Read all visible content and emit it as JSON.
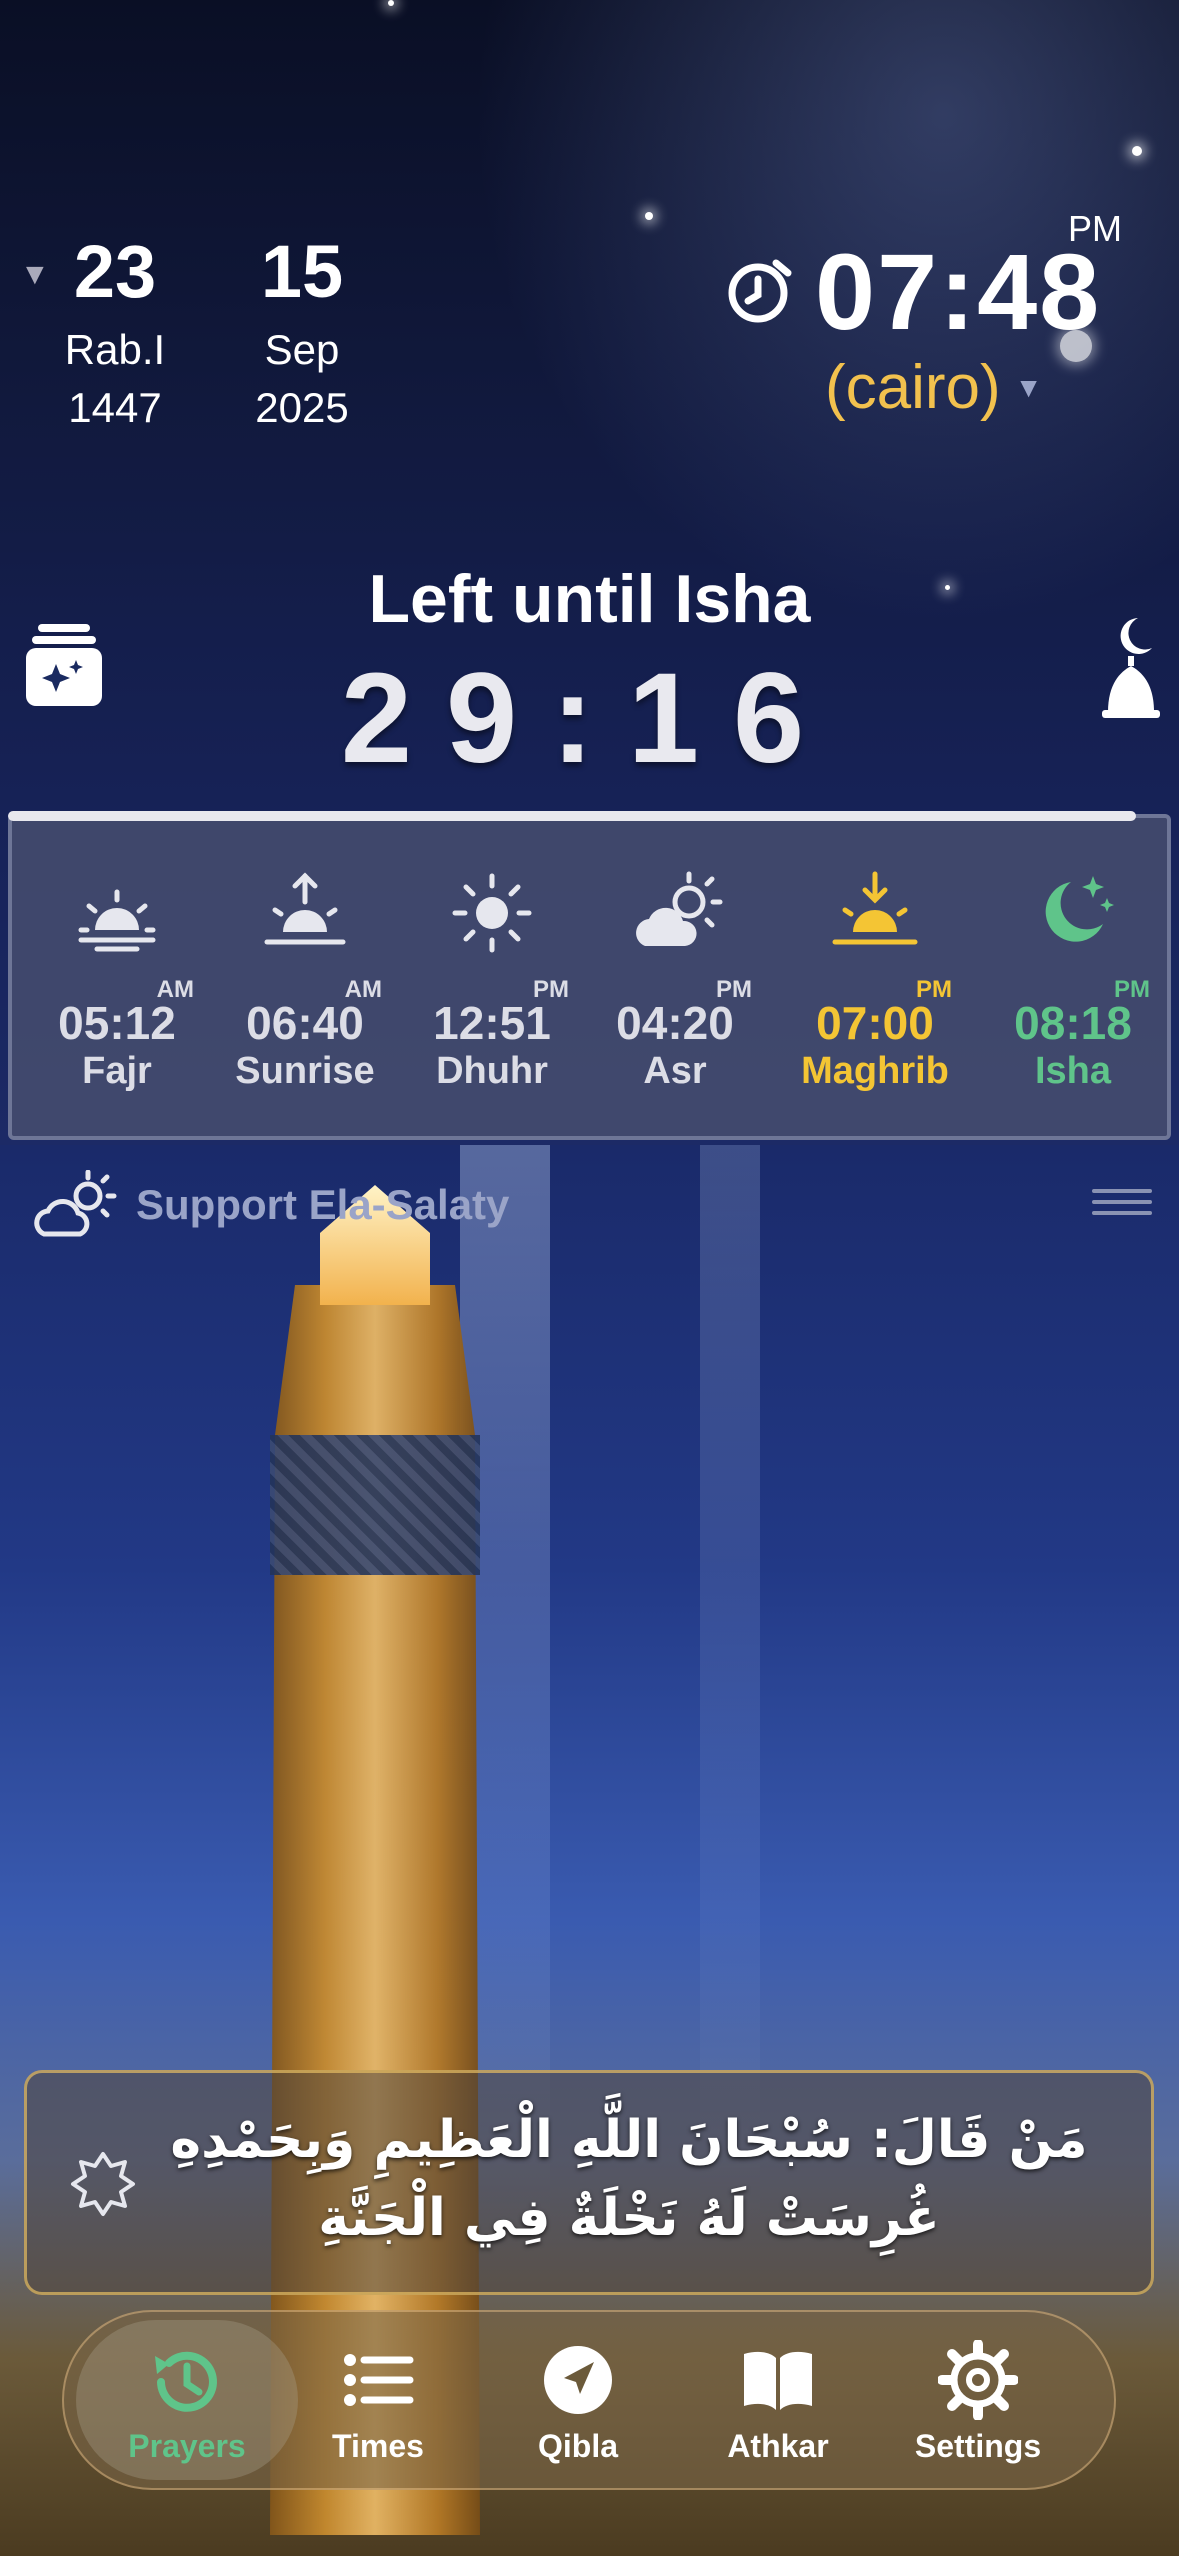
{
  "hijri": {
    "day": "23",
    "month": "Rab.I",
    "year": "1447"
  },
  "gregorian": {
    "day": "15",
    "month": "Sep",
    "year": "2025"
  },
  "clock": {
    "ampm": "PM",
    "time": "07:48",
    "city": "(cairo)"
  },
  "countdown": {
    "title": "Left until Isha",
    "value": "29:16",
    "progress_fraction": 0.97
  },
  "prayers": [
    {
      "name": "Fajr",
      "time": "05:12",
      "ampm": "AM",
      "icon": "sunrise-icon",
      "state": "normal"
    },
    {
      "name": "Sunrise",
      "time": "06:40",
      "ampm": "AM",
      "icon": "sun-up-icon",
      "state": "normal"
    },
    {
      "name": "Dhuhr",
      "time": "12:51",
      "ampm": "PM",
      "icon": "sun-icon",
      "state": "normal"
    },
    {
      "name": "Asr",
      "time": "04:20",
      "ampm": "PM",
      "icon": "cloud-sun-icon",
      "state": "normal"
    },
    {
      "name": "Maghrib",
      "time": "07:00",
      "ampm": "PM",
      "icon": "sunset-icon",
      "state": "current"
    },
    {
      "name": "Isha",
      "time": "08:18",
      "ampm": "PM",
      "icon": "moon-stars-icon",
      "state": "next"
    }
  ],
  "support": {
    "label": "Support Ela-Salaty",
    "icon": "cloud-sun-icon"
  },
  "quote": {
    "line1": "مَنْ قَالَ: سُبْحَانَ اللَّهِ الْعَظِيمِ وَبِحَمْدِهِ",
    "line2": "غُرِسَتْ لَهُ نَخْلَةٌ فِي الْجَنَّةِ"
  },
  "tabs": [
    {
      "label": "Prayers",
      "icon": "history-clock-icon",
      "active": true
    },
    {
      "label": "Times",
      "icon": "list-icon",
      "active": false
    },
    {
      "label": "Qibla",
      "icon": "navigation-arrow-icon",
      "active": false
    },
    {
      "label": "Athkar",
      "icon": "open-book-icon",
      "active": false
    },
    {
      "label": "Settings",
      "icon": "gear-icon",
      "active": false
    }
  ],
  "colors": {
    "gold": "#f4c534",
    "green": "#5fc48a",
    "city": "#f2c14e"
  }
}
